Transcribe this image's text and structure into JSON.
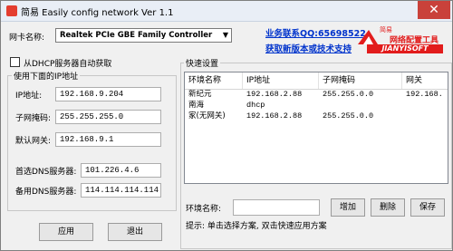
{
  "window": {
    "title": "简易 Easily config network Ver 1.1",
    "close_glyph": "✕"
  },
  "adapter": {
    "label": "网卡名称:",
    "selected": "Realtek PCIe GBE Family Controller"
  },
  "links": {
    "contact": "业务联系QQ:65698522",
    "updates": "获取新版本或技术支持"
  },
  "logo": {
    "top_text": "简易",
    "mid_text": "网络配置工具",
    "bottom_text": "JIANYISOFT",
    "brand_color": "#e21c1c"
  },
  "dhcp": {
    "label": "从DHCP服务器自动获取",
    "checked": false
  },
  "manual": {
    "group_title": "使用下面的IP地址",
    "ip_label": "IP地址:",
    "ip_value": "192.168.9.204",
    "mask_label": "子网掩码:",
    "mask_value": "255.255.255.0",
    "gw_label": "默认网关:",
    "gw_value": "192.168.9.1",
    "dns1_label": "首选DNS服务器:",
    "dns1_value": "101.226.4.6",
    "dns2_label": "备用DNS服务器:",
    "dns2_value": "114.114.114.114"
  },
  "buttons": {
    "apply": "应用",
    "exit": "退出",
    "add": "增加",
    "delete": "删除",
    "save": "保存"
  },
  "quick": {
    "group_title": "快速设置",
    "columns": [
      "环境名称",
      "IP地址",
      "子网掩码",
      "网关"
    ],
    "rows": [
      [
        "新纪元",
        "192.168.2.88",
        "255.255.0.0",
        "192.168."
      ],
      [
        "南海",
        "dhcp",
        "",
        ""
      ],
      [
        "家(无网关)",
        "192.168.2.88",
        "255.255.0.0",
        ""
      ]
    ],
    "env_label": "环境名称:",
    "env_value": "",
    "tip": "提示: 单击选择方案, 双击快速应用方案"
  }
}
